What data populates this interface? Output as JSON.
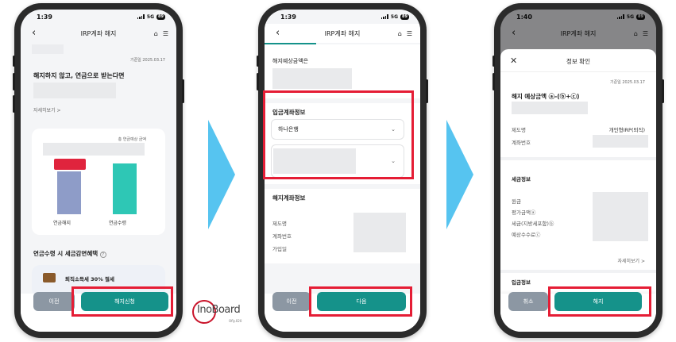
{
  "screen1": {
    "time": "1:39",
    "network": "5G",
    "battery": "89",
    "title": "IRP계좌 해지",
    "date": "기준일 2025.03.17",
    "headline": "해지하지 않고, 연금으로 받는다면",
    "details_link": "자세히보기 >",
    "chart_caption": "총 연금예상 금액",
    "bar1_label": "연금해지",
    "bar2_label": "연금수령",
    "benefits_title": "연금수령 시 세금감면혜택",
    "benefit_item": "퇴직소득세 30% 절세",
    "prev_button": "이전",
    "next_button": "해지신청"
  },
  "screen2": {
    "time": "1:39",
    "network": "5G",
    "battery": "89",
    "title": "IRP계좌 해지",
    "expected_label": "해지예상금액은",
    "deposit_title": "입금계좌정보",
    "bank_select": "하나은행",
    "closing_title": "해지계좌정보",
    "row1": "제도명",
    "row2": "계좌번호",
    "row3": "가입일",
    "prev_button": "이전",
    "next_button": "다음"
  },
  "screen3": {
    "time": "1:40",
    "network": "5G",
    "battery": "89",
    "title": "IRP계좌 해지",
    "sheet_title": "정보 확인",
    "date": "기준일 2025.03.17",
    "amount_title": "해지 예상금액 ⓐ-(ⓑ+ⓒ)",
    "row_plan": "제도명",
    "row_plan_value": "개인형IRP(퇴직)",
    "row_account": "계좌번호",
    "tax_title": "세금정보",
    "tax_row1": "원금",
    "tax_row2": "평가금액ⓐ",
    "tax_row3": "세금(지방세포함)ⓑ",
    "tax_row4": "예상수수료ⓒ",
    "details_link": "자세히보기 >",
    "deposit_title": "입금정보",
    "cancel_button": "취소",
    "confirm_button": "해지"
  },
  "logo": {
    "text": "InoBoard",
    "sub": "Ofly.020"
  },
  "colors": {
    "primary": "#15928a",
    "prev": "#8c97a3",
    "highlight": "#e51d35",
    "arrow": "#56c4f0",
    "bar_blue": "#8e9cc8",
    "bar_teal": "#2ec7b5"
  }
}
